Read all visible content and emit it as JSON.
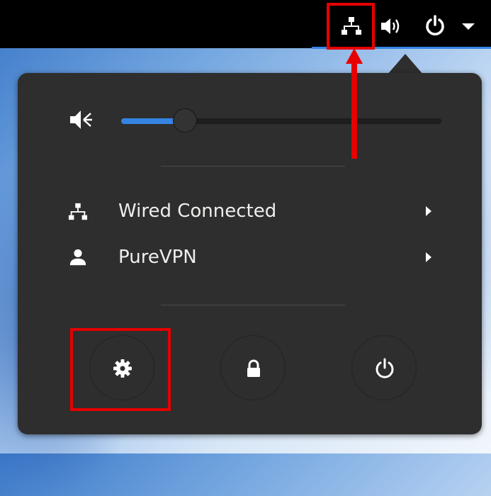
{
  "colors": {
    "accent": "#3584e4",
    "panel_bg": "#2e2e2e",
    "topbar_bg": "#000000",
    "annotation": "#e60000",
    "text": "#eeeeec"
  },
  "topbar": {
    "icons": [
      "network-wired-icon",
      "volume-icon",
      "power-icon",
      "menu-arrow-icon"
    ]
  },
  "menu": {
    "volume": {
      "icon": "volume-muted-icon",
      "level": 0.2
    },
    "items": [
      {
        "icon": "network-wired-icon",
        "label": "Wired Connected",
        "has_submenu": true
      },
      {
        "icon": "user-vpn-icon",
        "label": "PureVPN",
        "has_submenu": true
      }
    ],
    "actions": [
      {
        "icon": "gear-icon",
        "name": "settings"
      },
      {
        "icon": "lock-icon",
        "name": "lock"
      },
      {
        "icon": "power-icon",
        "name": "power-off"
      }
    ]
  },
  "annotations": {
    "highlighted": [
      "network-icon",
      "settings-button"
    ],
    "arrow_direction": "up"
  }
}
